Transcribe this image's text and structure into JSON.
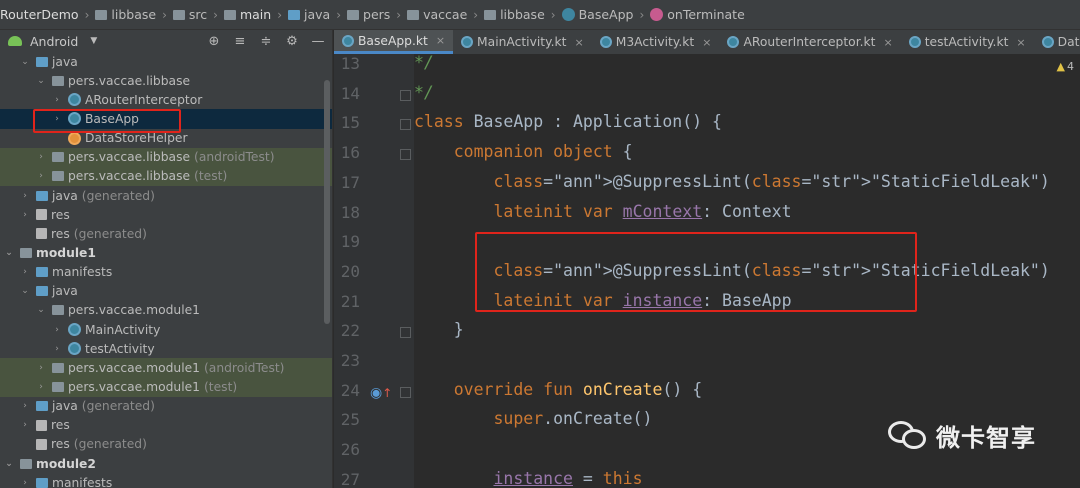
{
  "breadcrumb": [
    "RouterDemo",
    "libbase",
    "src",
    "main",
    "java",
    "pers",
    "vaccae",
    "libbase",
    "BaseApp",
    "onTerminate"
  ],
  "project_panel": {
    "view_label": "Android",
    "tree": [
      {
        "label": "java",
        "suffix": "",
        "icon": "folder-blue-icon"
      },
      {
        "label": "pers.vaccae.libbase",
        "suffix": "",
        "icon": "folder-gray-icon"
      },
      {
        "label": "ARouterInterceptor",
        "suffix": "",
        "icon": "kotlin-class-icon"
      },
      {
        "label": "BaseApp",
        "suffix": "",
        "icon": "kotlin-class-icon"
      },
      {
        "label": "DataStoreHelper",
        "suffix": "",
        "icon": "kotlin-file-icon"
      },
      {
        "label": "pers.vaccae.libbase",
        "suffix": "(androidTest)",
        "icon": "folder-gray-icon"
      },
      {
        "label": "pers.vaccae.libbase",
        "suffix": "(test)",
        "icon": "folder-gray-icon"
      },
      {
        "label": "java",
        "suffix": "(generated)",
        "icon": "folder-gen-icon"
      },
      {
        "label": "res",
        "suffix": "",
        "icon": "res-folder-icon"
      },
      {
        "label": "res",
        "suffix": "(generated)",
        "icon": "res-folder-icon"
      },
      {
        "label": "module1",
        "suffix": "",
        "icon": "module-icon"
      },
      {
        "label": "manifests",
        "suffix": "",
        "icon": "folder-blue-icon"
      },
      {
        "label": "java",
        "suffix": "",
        "icon": "folder-blue-icon"
      },
      {
        "label": "pers.vaccae.module1",
        "suffix": "",
        "icon": "folder-gray-icon"
      },
      {
        "label": "MainActivity",
        "suffix": "",
        "icon": "kotlin-class-icon"
      },
      {
        "label": "testActivity",
        "suffix": "",
        "icon": "kotlin-class-icon"
      },
      {
        "label": "pers.vaccae.module1",
        "suffix": "(androidTest)",
        "icon": "folder-gray-icon"
      },
      {
        "label": "pers.vaccae.module1",
        "suffix": "(test)",
        "icon": "folder-gray-icon"
      },
      {
        "label": "java",
        "suffix": "(generated)",
        "icon": "folder-gen-icon"
      },
      {
        "label": "res",
        "suffix": "",
        "icon": "res-folder-icon"
      },
      {
        "label": "res",
        "suffix": "(generated)",
        "icon": "res-folder-icon"
      },
      {
        "label": "module2",
        "suffix": "",
        "icon": "module-icon"
      },
      {
        "label": "manifests",
        "suffix": "",
        "icon": "folder-blue-icon"
      }
    ]
  },
  "tabs": [
    {
      "label": "BaseApp.kt",
      "active": true
    },
    {
      "label": "MainActivity.kt",
      "active": false
    },
    {
      "label": "M3Activity.kt",
      "active": false
    },
    {
      "label": "ARouterInterceptor.kt",
      "active": false
    },
    {
      "label": "testActivity.kt",
      "active": false
    },
    {
      "label": "DataStoreH",
      "active": false
    }
  ],
  "editor": {
    "warning_count": "4",
    "lines": [
      {
        "no": "13",
        "text": "*/"
      },
      {
        "no": "14",
        "text": "*/"
      },
      {
        "no": "15",
        "text": "class BaseApp : Application() {"
      },
      {
        "no": "16",
        "text": "    companion object {"
      },
      {
        "no": "17",
        "text": "        @SuppressLint(\"StaticFieldLeak\")"
      },
      {
        "no": "18",
        "text": "        lateinit var mContext: Context"
      },
      {
        "no": "19",
        "text": ""
      },
      {
        "no": "20",
        "text": "        @SuppressLint(\"StaticFieldLeak\")"
      },
      {
        "no": "21",
        "text": "        lateinit var instance: BaseApp"
      },
      {
        "no": "22",
        "text": "    }"
      },
      {
        "no": "23",
        "text": ""
      },
      {
        "no": "24",
        "text": "    override fun onCreate() {"
      },
      {
        "no": "25",
        "text": "        super.onCreate()"
      },
      {
        "no": "26",
        "text": ""
      },
      {
        "no": "27",
        "text": "        instance = this"
      }
    ]
  },
  "watermark": {
    "text": "微卡智享"
  },
  "colors": {
    "highlight": "#e0241b",
    "selection": "#0d293e",
    "test_row": "#49543f",
    "tab_accent": "#4a88c7"
  }
}
